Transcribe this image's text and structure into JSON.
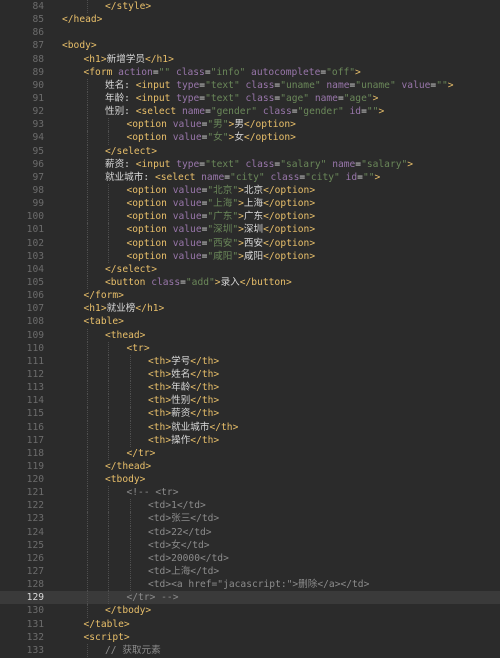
{
  "colors": {
    "background": "#2b2b2b",
    "line_number": "#6c6c6c",
    "tag": "#e8bf6a",
    "attribute": "#9876aa",
    "string": "#6a8759",
    "text": "#d8d8d8",
    "comment": "#8c8c8c",
    "active_line": "#3a3a3a"
  },
  "editor": {
    "active_line": 129,
    "lines": [
      {
        "n": 84,
        "indent": 2,
        "tokens": [
          [
            "t",
            "</style>"
          ]
        ]
      },
      {
        "n": 85,
        "indent": 0,
        "tokens": [
          [
            "t",
            "</head>"
          ]
        ]
      },
      {
        "n": 86,
        "indent": 0,
        "tokens": []
      },
      {
        "n": 87,
        "indent": 0,
        "tokens": [
          [
            "t",
            "<body>"
          ]
        ]
      },
      {
        "n": 88,
        "indent": 1,
        "tokens": [
          [
            "t",
            "<h1>"
          ],
          [
            "tx",
            "新增学员"
          ],
          [
            "t",
            "</h1>"
          ]
        ]
      },
      {
        "n": 89,
        "indent": 1,
        "tokens": [
          [
            "t",
            "<form "
          ],
          [
            "a",
            "action"
          ],
          [
            "tx",
            "="
          ],
          [
            "s",
            "\"\""
          ],
          [
            "tx",
            " "
          ],
          [
            "a",
            "class"
          ],
          [
            "tx",
            "="
          ],
          [
            "s",
            "\"info\""
          ],
          [
            "tx",
            " "
          ],
          [
            "a",
            "autocomplete"
          ],
          [
            "tx",
            "="
          ],
          [
            "s",
            "\"off\""
          ],
          [
            "t",
            ">"
          ]
        ]
      },
      {
        "n": 90,
        "indent": 2,
        "tokens": [
          [
            "tx",
            "姓名: "
          ],
          [
            "t",
            "<input "
          ],
          [
            "a",
            "type"
          ],
          [
            "tx",
            "="
          ],
          [
            "s",
            "\"text\""
          ],
          [
            "tx",
            " "
          ],
          [
            "a",
            "class"
          ],
          [
            "tx",
            "="
          ],
          [
            "s",
            "\"uname\""
          ],
          [
            "tx",
            " "
          ],
          [
            "a",
            "name"
          ],
          [
            "tx",
            "="
          ],
          [
            "s",
            "\"uname\""
          ],
          [
            "tx",
            " "
          ],
          [
            "a",
            "value"
          ],
          [
            "tx",
            "="
          ],
          [
            "s",
            "\"\""
          ],
          [
            "t",
            ">"
          ]
        ]
      },
      {
        "n": 91,
        "indent": 2,
        "tokens": [
          [
            "tx",
            "年龄: "
          ],
          [
            "t",
            "<input "
          ],
          [
            "a",
            "type"
          ],
          [
            "tx",
            "="
          ],
          [
            "s",
            "\"text\""
          ],
          [
            "tx",
            " "
          ],
          [
            "a",
            "class"
          ],
          [
            "tx",
            "="
          ],
          [
            "s",
            "\"age\""
          ],
          [
            "tx",
            " "
          ],
          [
            "a",
            "name"
          ],
          [
            "tx",
            "="
          ],
          [
            "s",
            "\"age\""
          ],
          [
            "t",
            ">"
          ]
        ]
      },
      {
        "n": 92,
        "indent": 2,
        "tokens": [
          [
            "tx",
            "性别: "
          ],
          [
            "t",
            "<select "
          ],
          [
            "a",
            "name"
          ],
          [
            "tx",
            "="
          ],
          [
            "s",
            "\"gender\""
          ],
          [
            "tx",
            " "
          ],
          [
            "a",
            "class"
          ],
          [
            "tx",
            "="
          ],
          [
            "s",
            "\"gender\""
          ],
          [
            "tx",
            " "
          ],
          [
            "a",
            "id"
          ],
          [
            "tx",
            "="
          ],
          [
            "s",
            "\"\""
          ],
          [
            "t",
            ">"
          ]
        ]
      },
      {
        "n": 93,
        "indent": 3,
        "tokens": [
          [
            "t",
            "<option "
          ],
          [
            "a",
            "value"
          ],
          [
            "tx",
            "="
          ],
          [
            "s",
            "\"男\""
          ],
          [
            "t",
            ">"
          ],
          [
            "tx",
            "男"
          ],
          [
            "t",
            "</option>"
          ]
        ]
      },
      {
        "n": 94,
        "indent": 3,
        "tokens": [
          [
            "t",
            "<option "
          ],
          [
            "a",
            "value"
          ],
          [
            "tx",
            "="
          ],
          [
            "s",
            "\"女\""
          ],
          [
            "t",
            ">"
          ],
          [
            "tx",
            "女"
          ],
          [
            "t",
            "</option>"
          ]
        ]
      },
      {
        "n": 95,
        "indent": 2,
        "tokens": [
          [
            "t",
            "</select>"
          ]
        ]
      },
      {
        "n": 96,
        "indent": 2,
        "tokens": [
          [
            "tx",
            "薪资: "
          ],
          [
            "t",
            "<input "
          ],
          [
            "a",
            "type"
          ],
          [
            "tx",
            "="
          ],
          [
            "s",
            "\"text\""
          ],
          [
            "tx",
            " "
          ],
          [
            "a",
            "class"
          ],
          [
            "tx",
            "="
          ],
          [
            "s",
            "\"salary\""
          ],
          [
            "tx",
            " "
          ],
          [
            "a",
            "name"
          ],
          [
            "tx",
            "="
          ],
          [
            "s",
            "\"salary\""
          ],
          [
            "t",
            ">"
          ]
        ]
      },
      {
        "n": 97,
        "indent": 2,
        "tokens": [
          [
            "tx",
            "就业城市: "
          ],
          [
            "t",
            "<select "
          ],
          [
            "a",
            "name"
          ],
          [
            "tx",
            "="
          ],
          [
            "s",
            "\"city\""
          ],
          [
            "tx",
            " "
          ],
          [
            "a",
            "class"
          ],
          [
            "tx",
            "="
          ],
          [
            "s",
            "\"city\""
          ],
          [
            "tx",
            " "
          ],
          [
            "a",
            "id"
          ],
          [
            "tx",
            "="
          ],
          [
            "s",
            "\"\""
          ],
          [
            "t",
            ">"
          ]
        ]
      },
      {
        "n": 98,
        "indent": 3,
        "tokens": [
          [
            "t",
            "<option "
          ],
          [
            "a",
            "value"
          ],
          [
            "tx",
            "="
          ],
          [
            "s",
            "\"北京\""
          ],
          [
            "t",
            ">"
          ],
          [
            "tx",
            "北京"
          ],
          [
            "t",
            "</option>"
          ]
        ]
      },
      {
        "n": 99,
        "indent": 3,
        "tokens": [
          [
            "t",
            "<option "
          ],
          [
            "a",
            "value"
          ],
          [
            "tx",
            "="
          ],
          [
            "s",
            "\"上海\""
          ],
          [
            "t",
            ">"
          ],
          [
            "tx",
            "上海"
          ],
          [
            "t",
            "</option>"
          ]
        ]
      },
      {
        "n": 100,
        "indent": 3,
        "tokens": [
          [
            "t",
            "<option "
          ],
          [
            "a",
            "value"
          ],
          [
            "tx",
            "="
          ],
          [
            "s",
            "\"广东\""
          ],
          [
            "t",
            ">"
          ],
          [
            "tx",
            "广东"
          ],
          [
            "t",
            "</option>"
          ]
        ]
      },
      {
        "n": 101,
        "indent": 3,
        "tokens": [
          [
            "t",
            "<option "
          ],
          [
            "a",
            "value"
          ],
          [
            "tx",
            "="
          ],
          [
            "s",
            "\"深圳\""
          ],
          [
            "t",
            ">"
          ],
          [
            "tx",
            "深圳"
          ],
          [
            "t",
            "</option>"
          ]
        ]
      },
      {
        "n": 102,
        "indent": 3,
        "tokens": [
          [
            "t",
            "<option "
          ],
          [
            "a",
            "value"
          ],
          [
            "tx",
            "="
          ],
          [
            "s",
            "\"西安\""
          ],
          [
            "t",
            ">"
          ],
          [
            "tx",
            "西安"
          ],
          [
            "t",
            "</option>"
          ]
        ]
      },
      {
        "n": 103,
        "indent": 3,
        "tokens": [
          [
            "t",
            "<option "
          ],
          [
            "a",
            "value"
          ],
          [
            "tx",
            "="
          ],
          [
            "s",
            "\"咸阳\""
          ],
          [
            "t",
            ">"
          ],
          [
            "tx",
            "咸阳"
          ],
          [
            "t",
            "</option>"
          ]
        ]
      },
      {
        "n": 104,
        "indent": 2,
        "tokens": [
          [
            "t",
            "</select>"
          ]
        ]
      },
      {
        "n": 105,
        "indent": 2,
        "tokens": [
          [
            "t",
            "<button "
          ],
          [
            "a",
            "class"
          ],
          [
            "tx",
            "="
          ],
          [
            "s",
            "\"add\""
          ],
          [
            "t",
            ">"
          ],
          [
            "tx",
            "录入"
          ],
          [
            "t",
            "</button>"
          ]
        ]
      },
      {
        "n": 106,
        "indent": 1,
        "tokens": [
          [
            "t",
            "</form>"
          ]
        ]
      },
      {
        "n": 107,
        "indent": 1,
        "tokens": [
          [
            "t",
            "<h1>"
          ],
          [
            "tx",
            "就业榜"
          ],
          [
            "t",
            "</h1>"
          ]
        ]
      },
      {
        "n": 108,
        "indent": 1,
        "tokens": [
          [
            "t",
            "<table>"
          ]
        ]
      },
      {
        "n": 109,
        "indent": 2,
        "tokens": [
          [
            "t",
            "<thead>"
          ]
        ]
      },
      {
        "n": 110,
        "indent": 3,
        "tokens": [
          [
            "t",
            "<tr>"
          ]
        ]
      },
      {
        "n": 111,
        "indent": 4,
        "tokens": [
          [
            "t",
            "<th>"
          ],
          [
            "tx",
            "学号"
          ],
          [
            "t",
            "</th>"
          ]
        ]
      },
      {
        "n": 112,
        "indent": 4,
        "tokens": [
          [
            "t",
            "<th>"
          ],
          [
            "tx",
            "姓名"
          ],
          [
            "t",
            "</th>"
          ]
        ]
      },
      {
        "n": 113,
        "indent": 4,
        "tokens": [
          [
            "t",
            "<th>"
          ],
          [
            "tx",
            "年龄"
          ],
          [
            "t",
            "</th>"
          ]
        ]
      },
      {
        "n": 114,
        "indent": 4,
        "tokens": [
          [
            "t",
            "<th>"
          ],
          [
            "tx",
            "性别"
          ],
          [
            "t",
            "</th>"
          ]
        ]
      },
      {
        "n": 115,
        "indent": 4,
        "tokens": [
          [
            "t",
            "<th>"
          ],
          [
            "tx",
            "薪资"
          ],
          [
            "t",
            "</th>"
          ]
        ]
      },
      {
        "n": 116,
        "indent": 4,
        "tokens": [
          [
            "t",
            "<th>"
          ],
          [
            "tx",
            "就业城市"
          ],
          [
            "t",
            "</th>"
          ]
        ]
      },
      {
        "n": 117,
        "indent": 4,
        "tokens": [
          [
            "t",
            "<th>"
          ],
          [
            "tx",
            "操作"
          ],
          [
            "t",
            "</th>"
          ]
        ]
      },
      {
        "n": 118,
        "indent": 3,
        "tokens": [
          [
            "t",
            "</tr>"
          ]
        ]
      },
      {
        "n": 119,
        "indent": 2,
        "tokens": [
          [
            "t",
            "</thead>"
          ]
        ]
      },
      {
        "n": 120,
        "indent": 2,
        "tokens": [
          [
            "t",
            "<tbody>"
          ]
        ]
      },
      {
        "n": 121,
        "indent": 3,
        "tokens": [
          [
            "cm",
            "<!-- <tr>"
          ]
        ]
      },
      {
        "n": 122,
        "indent": 4,
        "tokens": [
          [
            "cm",
            "<td>1</td>"
          ]
        ]
      },
      {
        "n": 123,
        "indent": 4,
        "tokens": [
          [
            "cm",
            "<td>张三</td>"
          ]
        ]
      },
      {
        "n": 124,
        "indent": 4,
        "tokens": [
          [
            "cm",
            "<td>22</td>"
          ]
        ]
      },
      {
        "n": 125,
        "indent": 4,
        "tokens": [
          [
            "cm",
            "<td>女</td>"
          ]
        ]
      },
      {
        "n": 126,
        "indent": 4,
        "tokens": [
          [
            "cm",
            "<td>20000</td>"
          ]
        ]
      },
      {
        "n": 127,
        "indent": 4,
        "tokens": [
          [
            "cm",
            "<td>上海</td>"
          ]
        ]
      },
      {
        "n": 128,
        "indent": 4,
        "tokens": [
          [
            "cm",
            "<td><a href=\"jacascript:\">删除</a></td>"
          ]
        ]
      },
      {
        "n": 129,
        "indent": 3,
        "tokens": [
          [
            "cm",
            "</tr> -->"
          ]
        ]
      },
      {
        "n": 130,
        "indent": 2,
        "tokens": [
          [
            "t",
            "</tbody>"
          ]
        ]
      },
      {
        "n": 131,
        "indent": 1,
        "tokens": [
          [
            "t",
            "</table>"
          ]
        ]
      },
      {
        "n": 132,
        "indent": 1,
        "tokens": [
          [
            "t",
            "<script>"
          ]
        ]
      },
      {
        "n": 133,
        "indent": 2,
        "tokens": [
          [
            "cm",
            "// 获取元素"
          ]
        ]
      }
    ]
  }
}
